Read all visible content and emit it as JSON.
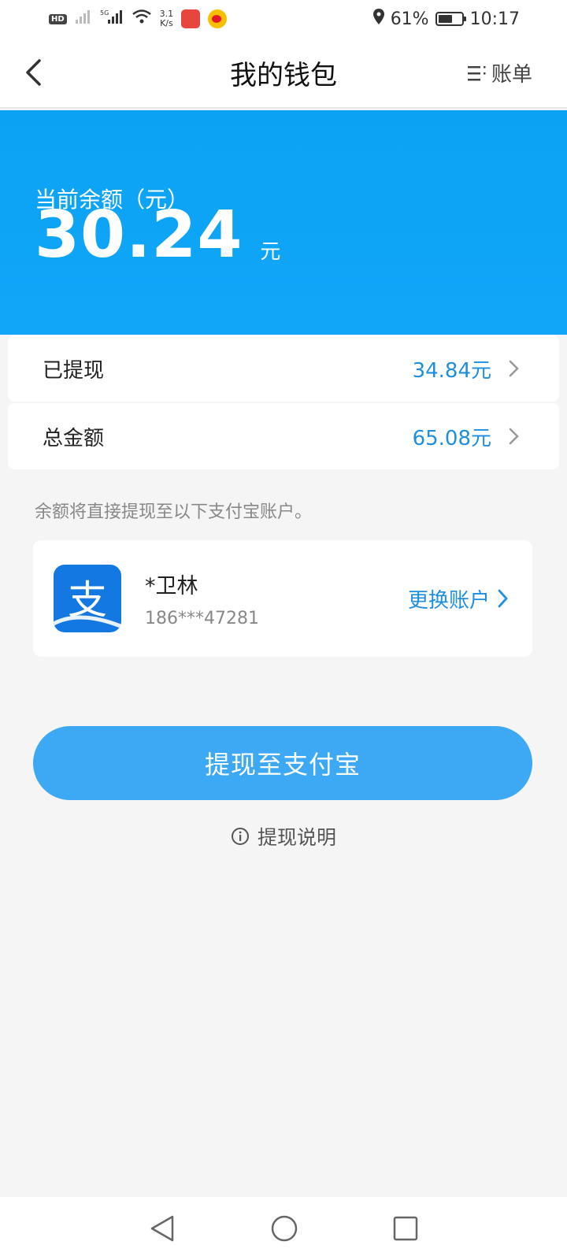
{
  "status_bar": {
    "hd_label": "HD",
    "network_speed_value": "3.1",
    "network_speed_unit": "K/s",
    "battery_percent": "61%",
    "time": "10:17",
    "battery_level": 0.61
  },
  "header": {
    "title": "我的钱包",
    "bill_label": "账单"
  },
  "balance": {
    "label": "当前余额（元）",
    "amount": "30.24",
    "unit": "元"
  },
  "summary_rows": [
    {
      "label": "已提现",
      "value": "34.84元"
    },
    {
      "label": "总金额",
      "value": "65.08元"
    }
  ],
  "withdraw_tip": "余额将直接提现至以下支付宝账户。",
  "account": {
    "logo_char": "支",
    "name": "*卫林",
    "phone": "186***47281",
    "change_label": "更换账户"
  },
  "actions": {
    "withdraw_button": "提现至支付宝",
    "help_label": "提现说明"
  },
  "colors": {
    "accent": "#0aa3f3",
    "link": "#1e8fe0",
    "button": "#3da8f4",
    "alipay": "#1478e2"
  }
}
